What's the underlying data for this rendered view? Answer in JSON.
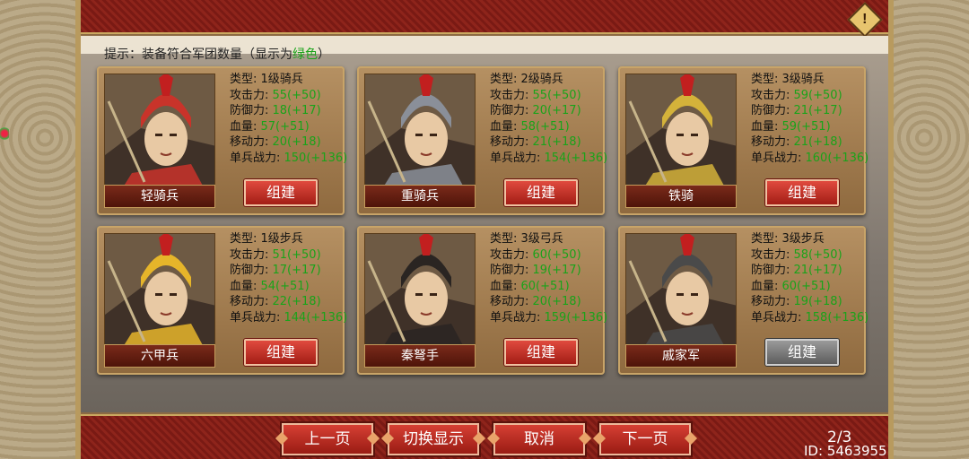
{
  "hint": {
    "prefix": "提示：装备符合军团数量（显示为",
    "green": "绿色",
    "suffix": "）"
  },
  "labels": {
    "type": "类型: ",
    "attack": "攻击力: ",
    "defense": "防御力: ",
    "hp": "血量: ",
    "move": "移动力: ",
    "power": "单兵战力: "
  },
  "units": [
    {
      "name": "轻骑兵",
      "type": "1级骑兵",
      "attack": "55(+50)",
      "defense": "18(+17)",
      "hp": "57(+51)",
      "move": "20(+18)",
      "power": "150(+136)",
      "button": "组建",
      "enabled": true,
      "helmet": "#c9332a"
    },
    {
      "name": "重骑兵",
      "type": "2级骑兵",
      "attack": "55(+50)",
      "defense": "20(+17)",
      "hp": "58(+51)",
      "move": "21(+18)",
      "power": "154(+136)",
      "button": "组建",
      "enabled": true,
      "helmet": "#8a8f99"
    },
    {
      "name": "铁骑",
      "type": "3级骑兵",
      "attack": "59(+50)",
      "defense": "21(+17)",
      "hp": "59(+51)",
      "move": "21(+18)",
      "power": "160(+136)",
      "button": "组建",
      "enabled": true,
      "helmet": "#d4b23a"
    },
    {
      "name": "六甲兵",
      "type": "1级步兵",
      "attack": "51(+50)",
      "defense": "17(+17)",
      "hp": "54(+51)",
      "move": "22(+18)",
      "power": "144(+136)",
      "button": "组建",
      "enabled": true,
      "helmet": "#e6b52a"
    },
    {
      "name": "秦弩手",
      "type": "3级弓兵",
      "attack": "60(+50)",
      "defense": "19(+17)",
      "hp": "60(+51)",
      "move": "20(+18)",
      "power": "159(+136)",
      "button": "组建",
      "enabled": true,
      "helmet": "#2a2522"
    },
    {
      "name": "戚家军",
      "type": "3级步兵",
      "attack": "58(+50)",
      "defense": "21(+17)",
      "hp": "60(+51)",
      "move": "19(+18)",
      "power": "158(+136)",
      "button": "组建",
      "enabled": false,
      "helmet": "#4a4a4a"
    }
  ],
  "nav": {
    "prev": "上一页",
    "toggle": "切换显示",
    "cancel": "取消",
    "next": "下一页"
  },
  "page": "2/3",
  "id": "ID: 5463955",
  "alert_icon": "!",
  "colors": {
    "accent_red": "#c9332a",
    "stat_green": "#1aa31a",
    "frame_gold": "#c8a468"
  }
}
